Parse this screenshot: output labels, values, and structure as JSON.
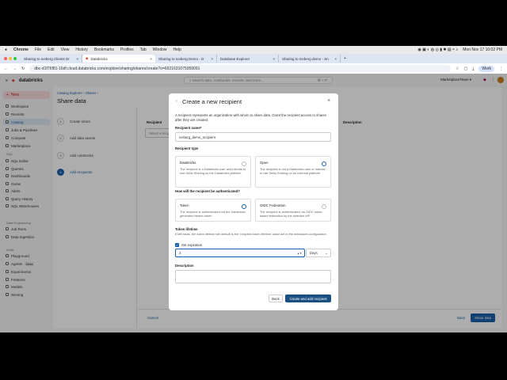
{
  "menubar": {
    "app": "Chrome",
    "items": [
      "File",
      "Edit",
      "View",
      "History",
      "Bookmarks",
      "Profiles",
      "Tab",
      "Window",
      "Help"
    ],
    "datetime": "Mon Nov 17  10:02 PM"
  },
  "tabs": [
    {
      "label": "Sharing to Iceberg Clients Dr"
    },
    {
      "label": "Databricks"
    },
    {
      "label": "Sharing to Iceberg Demo - D"
    },
    {
      "label": "Database Explorer"
    },
    {
      "label": "Sharing to Iceberg demo - Sn"
    }
  ],
  "address": {
    "url": "dbc-d1f76f81-16df.cloud.databricks.com/explore/sharing/shares/create?o=6921631075959091",
    "profile": "Work"
  },
  "header": {
    "logo": "databricks",
    "search_placeholder": "Search data, notebooks, recents, and more...",
    "shortcut": "⌘ + P",
    "workspace": "MarketplaceTeam ▾"
  },
  "sidebar": {
    "new": "New",
    "items": [
      "Workspace",
      "Recents",
      "Catalog",
      "Jobs & Pipelines",
      "Compute",
      "Marketplace"
    ],
    "sql_title": "SQL",
    "sql": [
      "SQL Editor",
      "Queries",
      "Dashboards",
      "Genie",
      "Alerts",
      "Query History",
      "SQL Warehouses"
    ],
    "de_title": "Data Engineering",
    "de": [
      "Job Runs",
      "Data Ingestion"
    ],
    "ai_title": "AI/ML",
    "ai": [
      "Playground",
      "Agents",
      "Experiments",
      "Features",
      "Models",
      "Serving"
    ],
    "beta": "Beta"
  },
  "page": {
    "breadcrumb": [
      "Catalog Explorer",
      "Shares"
    ],
    "title": "Share data",
    "steps": [
      "Create share",
      "Add data assets",
      "Add notebooks",
      "Add recipients"
    ],
    "recipient_col": "Recipient",
    "recipient_placeholder": "Select a recipient",
    "description_col": "Description",
    "cancel": "Cancel",
    "back": "Back",
    "share": "Share data"
  },
  "modal": {
    "title": "Create a new recipient",
    "intro": "A recipient represents an organization with whom to share data. Grant the recipient access to shares after they are created.",
    "name_label": "Recipient name*",
    "name_value": "iceberg_demo_recipient",
    "type_label": "Recipient type",
    "type_options": [
      {
        "title": "Databricks",
        "desc": "The recipient is a Databricks user and intends to use Delta Sharing on the Databricks platform",
        "selected": false
      },
      {
        "title": "Open",
        "desc": "The recipient is not a Databricks user or intends to use Delta Sharing on an external platform",
        "selected": true
      }
    ],
    "auth_label": "How will the recipient be authenticated?",
    "auth_options": [
      {
        "title": "Token",
        "desc": "The recipient is authenticated via the Databricks generated bearer token",
        "selected": true
      },
      {
        "title": "OIDC Federation",
        "desc": "The recipient is authenticated via OIDC token-based federation by the selected IdP",
        "selected": false
      }
    ],
    "lifetime_label": "Token lifetime",
    "lifetime_help": "If left blank, the token lifetime will default to the 'recipient token lifetime' value set in the metastore configuration.",
    "expiration_label": "Set expiration",
    "expiration_checked": true,
    "expiration_value": "3",
    "unit": "Days",
    "desc_label": "Description",
    "back": "Back",
    "create": "Create and add recipient"
  },
  "colors": {
    "accent": "#1b5fa8"
  }
}
